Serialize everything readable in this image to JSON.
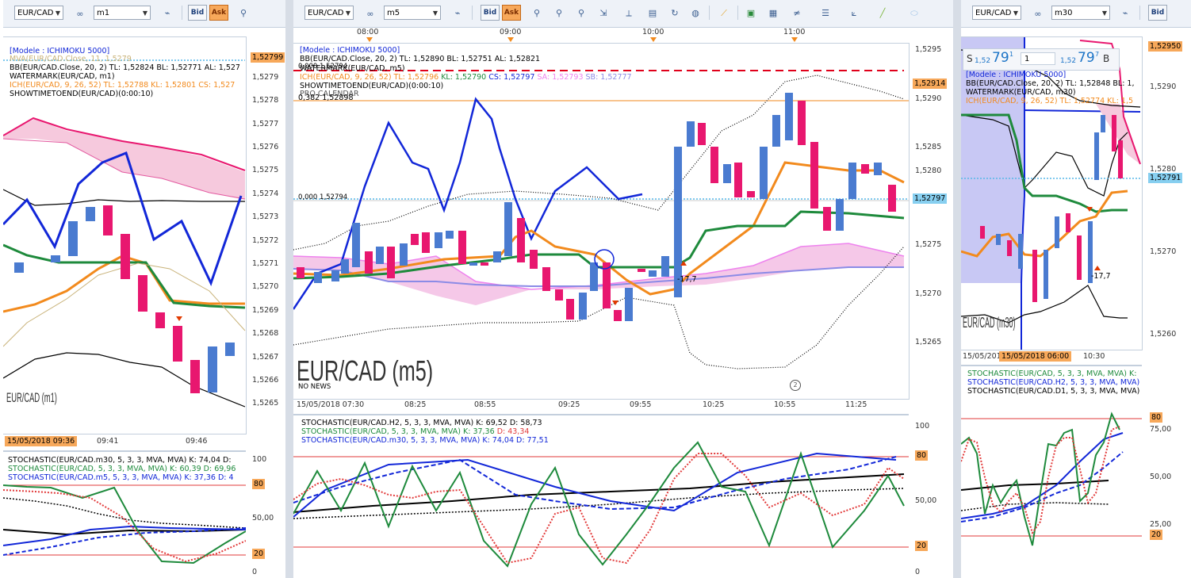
{
  "colors": {
    "bull": "#4a7bd0",
    "bear": "#e8176f",
    "kumo": "#f6c9dd",
    "bb": "#000000",
    "tenkan": "#f28a1d",
    "kijun": "#1e8a3c",
    "ma": "#1227d8"
  },
  "left": {
    "symbol": "EUR/CAD",
    "timeframe": "m1",
    "bid_label": "Bid",
    "ask_label": "Ask",
    "ind_model": "[Modele : ICHIMOKU 5000]",
    "ind_mva": "MVA(EUR/CAD.Close, 11, 1,5279",
    "ind_bb": "BB(EUR/CAD.Close, 20, 2)  TL: 1,52824  BL: 1,52771  AL: 1,527",
    "ind_wm": "WATERMARK(EUR/CAD, m1)",
    "ind_ich": "ICH(EUR/CAD, 9, 26, 52)  TL: 1,52788  KL: 1,52801  CS: 1,527",
    "ind_show": "SHOWTIMETOEND(EUR/CAD)(0:00:10)",
    "price_tag": "1,52799",
    "prices": [
      "1,5279",
      "1,5278",
      "1,5277",
      "1,5276",
      "1,5275",
      "1,5274",
      "1,5273",
      "1,5272",
      "1,5271",
      "1,5270",
      "1,5269",
      "1,5268",
      "1,5267",
      "1,5266",
      "1,5265"
    ],
    "watermark": "EUR/CAD (m1)",
    "date_tag": "15/05/2018 09:36",
    "times": [
      "09:41",
      "09:46"
    ],
    "stoch1": "STOCHASTIC(EUR/CAD.m30, 5, 3, 3, MVA, MVA)  K: 74,04  D:",
    "stoch2": "STOCHASTIC(EUR/CAD, 5, 3, 3, MVA, MVA)  K: 60,39  D: 69,96",
    "stoch3": "STOCHASTIC(EUR/CAD.m5, 5, 3, 3, MVA, MVA)  K: 37,36  D: 4",
    "stoch_axis": [
      "100",
      "80",
      "50,00",
      "20",
      "0"
    ]
  },
  "mid": {
    "symbol": "EUR/CAD",
    "timeframe": "m5",
    "bid_label": "Bid",
    "ask_label": "Ask",
    "top_times": [
      "08:00",
      "09:00",
      "10:00",
      "11:00"
    ],
    "ind_model": "[Modele : ICHIMOKU 5000]",
    "ind_bb": "BB(EUR/CAD.Close, 20, 2)  TL: 1,52890  BL: 1,52751  AL: 1,52821",
    "ind_wm": "WATERMARK(EUR/CAD, m5)",
    "ind_fib0": "0,000 1,52794",
    "ind_ich_a": "ICH(EUR/CAD, 9, 26, 52)  TL: 1,52796",
    "ind_ich_b": "KL: 1,52790",
    "ind_ich_c": "CS: 1,52797",
    "ind_ich_d": "SA: 1,52793",
    "ind_ich_e": "SB: 1,52777",
    "ind_show": "SHOWTIMETOEND(EUR/CAD)(0:00:10)",
    "ind_cal": "PRO CALENDAR",
    "ind_fib382": "0,382 1,52898",
    "fib_mid": "0,000 1,52794",
    "price_tag_top": "1,52914",
    "price_tag_cur": "1,52797",
    "prices": [
      "1,5295",
      "1,5290",
      "1,5285",
      "1,5280",
      "1,5275",
      "1,5270",
      "1,5265"
    ],
    "label_177": "-17,7",
    "watermark": "EUR/CAD (m5)",
    "no_news": "NO NEWS",
    "bottom_date": "15/05/2018 07:30",
    "times": [
      "08:25",
      "08:55",
      "09:25",
      "09:55",
      "10:25",
      "10:55",
      "11:25"
    ],
    "stoch1": "STOCHASTIC(EUR/CAD.H2, 5, 3, 3, MVA, MVA)  K: 69,52  D: 58,73",
    "stoch2a": "STOCHASTIC(EUR/CAD, 5, 3, 3, MVA, MVA)  K: 37,36",
    "stoch2b": "D: 43,34",
    "stoch3": "STOCHASTIC(EUR/CAD.m30, 5, 3, 3, MVA, MVA)  K: 74,04  D: 77,51",
    "stoch_axis": [
      "100",
      "80",
      "50,00",
      "20",
      "0"
    ]
  },
  "right": {
    "symbol": "EUR/CAD",
    "timeframe": "m30",
    "bid_label": "Bid",
    "price_tag_top": "1,52950",
    "price_tag_cur": "1,52791",
    "quote_sell_prefix": "S",
    "quote_sell_small": "1,52",
    "quote_sell_big": "79",
    "quote_sell_sup": "1",
    "quote_qty": "1",
    "quote_buy_small": "1,52",
    "quote_buy_big": "79",
    "quote_buy_sup": "7",
    "quote_buy_suffix": "B",
    "ind_model": "[Modele : ICHIMOKU 5000]",
    "ind_bb": "BB(EUR/CAD.Close, 20, 2)  TL: 1,52848  BL: 1,",
    "ind_wm": "WATERMARK(EUR/CAD, m30)",
    "ind_ich": "ICH(EUR/CAD, 9, 26, 52)  TL: 1,52774  KL: 1,5",
    "prices": [
      "1,5290",
      "1,5280",
      "1,5270",
      "1,5260"
    ],
    "label_177": "-17,7",
    "watermark": "EUR/CAD (m30)",
    "date_prefix": "15/05/201",
    "date_tag": "15/05/2018 06:00",
    "times": [
      "10:30"
    ],
    "stoch1": "STOCHASTIC(EUR/CAD, 5, 3, 3, MVA, MVA)  K:",
    "stoch2": "STOCHASTIC(EUR/CAD.H2, 5, 3, 3, MVA, MVA)",
    "stoch3": "STOCHASTIC(EUR/CAD.D1, 5, 3, 3, MVA, MVA)",
    "stoch_axis": [
      "80",
      "75,00",
      "50,00",
      "25,00",
      "20"
    ]
  }
}
